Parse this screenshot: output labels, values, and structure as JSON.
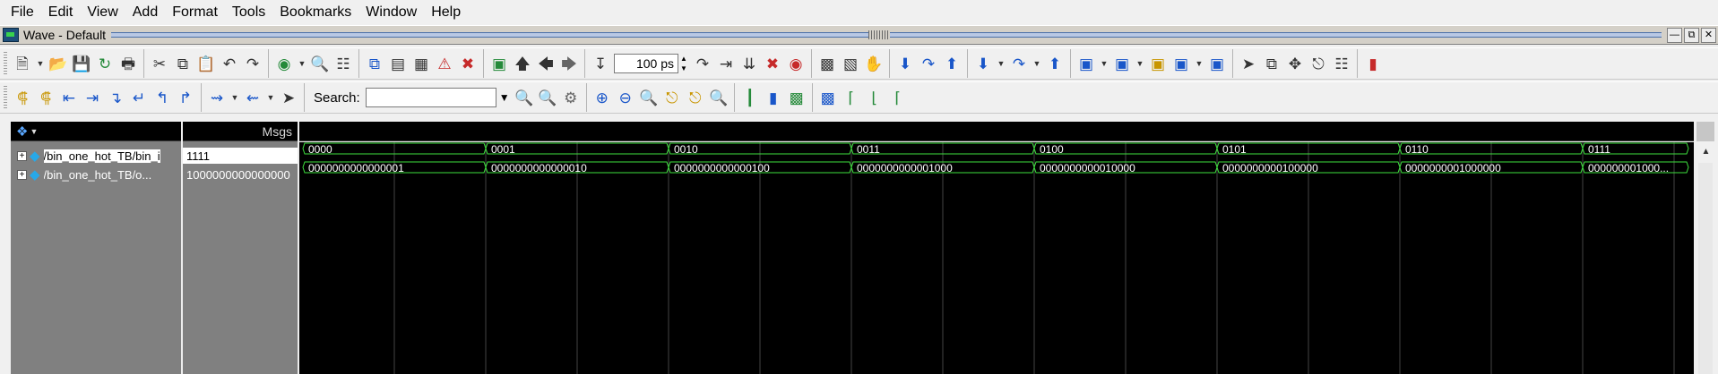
{
  "menu": [
    "File",
    "Edit",
    "View",
    "Add",
    "Format",
    "Tools",
    "Bookmarks",
    "Window",
    "Help"
  ],
  "title": "Wave - Default",
  "toolbar": {
    "zoom_value": "100 ps",
    "search_label": "Search:",
    "search_placeholder": ""
  },
  "wave": {
    "msgs_header": "Msgs",
    "signals": [
      {
        "name": "/bin_one_hot_TB/bin_i",
        "value": "1111"
      },
      {
        "name": "/bin_one_hot_TB/o...",
        "value": "1000000000000000"
      }
    ],
    "bin_segments": [
      "0000",
      "0001",
      "0010",
      "0011",
      "0100",
      "0101",
      "0110",
      "0111"
    ],
    "onehot_segments": [
      "0000000000000001",
      "0000000000000010",
      "0000000000000100",
      "0000000000001000",
      "0000000000010000",
      "0000000000100000",
      "0000000001000000",
      "000000001000..."
    ],
    "trace_color": "#3ee03e",
    "grid_color": "#444444"
  }
}
